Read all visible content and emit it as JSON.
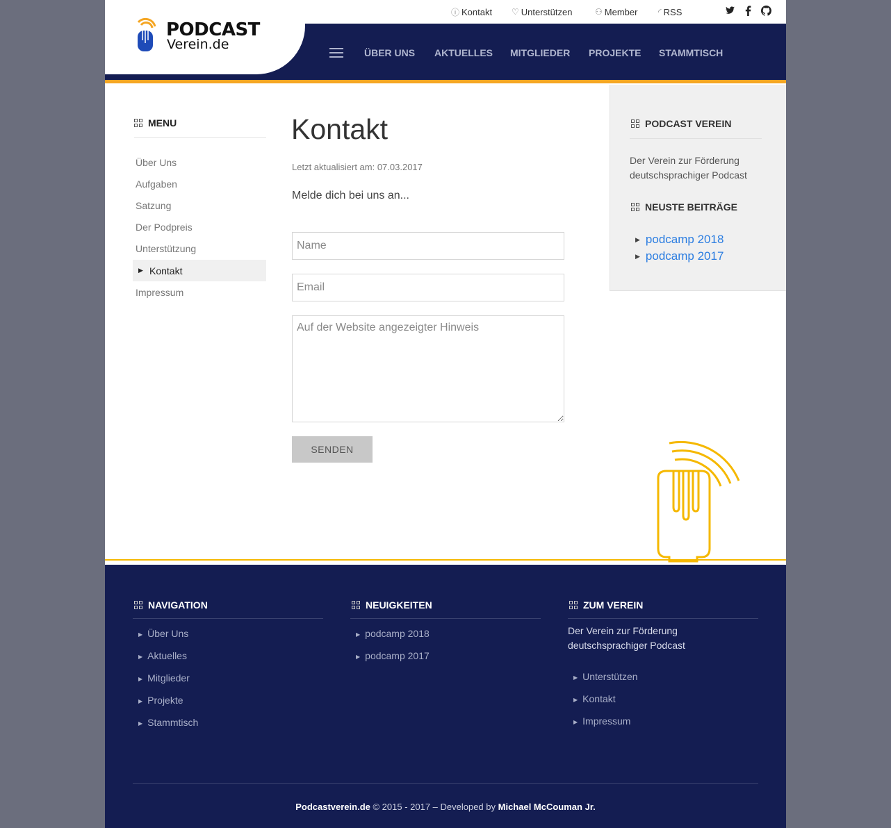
{
  "topbar": {
    "kontakt": "Kontakt",
    "unterstuetzen": "Unterstützen",
    "member": "Member",
    "rss": "RSS"
  },
  "logo": {
    "line1": "PODCAST",
    "line2": "Verein.de"
  },
  "nav": [
    "ÜBER UNS",
    "AKTUELLES",
    "MITGLIEDER",
    "PROJEKTE",
    "STAMMTISCH"
  ],
  "left_menu": {
    "heading": "MENU",
    "items": [
      "Über Uns",
      "Aufgaben",
      "Satzung",
      "Der Podpreis",
      "Unterstützung",
      "Kontakt",
      "Impressum"
    ]
  },
  "main": {
    "title": "Kontakt",
    "updated": "Letzt aktualisiert am: 07.03.2017",
    "intro": "Melde dich bei uns an...",
    "name_placeholder": "Name",
    "email_placeholder": "Email",
    "message_placeholder": "Auf der Website angezeigter Hinweis",
    "submit": "SENDEN"
  },
  "sidebar": {
    "heading1": "PODCAST VEREIN",
    "text": "Der Verein zur Förderung deutschsprachiger Podcast",
    "heading2": "NEUSTE BEITRÄGE",
    "posts": [
      "podcamp 2018",
      "podcamp 2017"
    ]
  },
  "footer": {
    "nav_heading": "NAVIGATION",
    "nav_items": [
      "Über Uns",
      "Aktuelles",
      "Mitglieder",
      "Projekte",
      "Stammtisch"
    ],
    "news_heading": "NEUIGKEITEN",
    "news_items": [
      "podcamp 2018",
      "podcamp 2017"
    ],
    "verein_heading": "ZUM VEREIN",
    "verein_text": "Der Verein zur Förderung deutschsprachiger Podcast",
    "verein_items": [
      "Unterstützen",
      "Kontakt",
      "Impressum"
    ],
    "copyright_site": "Podcastverein.de",
    "copyright_mid": " © 2015 - 2017 – Developed by ",
    "copyright_author": "Michael McCouman Jr."
  },
  "colors": {
    "navy": "#141d52",
    "orange": "#f5a623",
    "yellow": "#f5b800",
    "link": "#2b7de1"
  }
}
